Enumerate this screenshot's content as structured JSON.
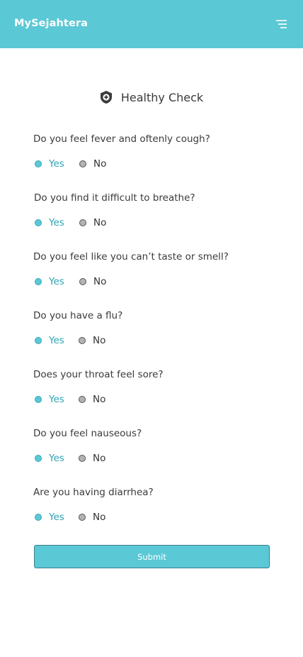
{
  "header": {
    "app_title": "MySejahtera",
    "menu_icon": "menu-icon",
    "color": "#5bc8d6"
  },
  "page": {
    "title_icon": "shield-plus-icon",
    "title": "Healthy Check"
  },
  "questions": [
    {
      "text": "Do you feel fever and oftenly cough?",
      "yes_label": "Yes",
      "no_label": "No",
      "selected": "yes"
    },
    {
      "text": "Do you find it difficult to breathe?",
      "yes_label": "Yes",
      "no_label": "No",
      "selected": "yes"
    },
    {
      "text": "Do you feel like you can’t taste or smell?",
      "yes_label": "Yes",
      "no_label": "No",
      "selected": "yes"
    },
    {
      "text": "Do you have a flu?",
      "yes_label": "Yes",
      "no_label": "No",
      "selected": "yes"
    },
    {
      "text": "Does your throat feel sore?",
      "yes_label": "Yes",
      "no_label": "No",
      "selected": "yes"
    },
    {
      "text": "Do you feel nauseous?",
      "yes_label": "Yes",
      "no_label": "No",
      "selected": "yes"
    },
    {
      "text": "Are you having diarrhea?",
      "yes_label": "Yes",
      "no_label": "No",
      "selected": "yes"
    }
  ],
  "submit_label": "Submit",
  "colors": {
    "accent": "#5bc8d6",
    "yes_text": "#2ea3b3",
    "no_dot": "#b3b3b3"
  }
}
